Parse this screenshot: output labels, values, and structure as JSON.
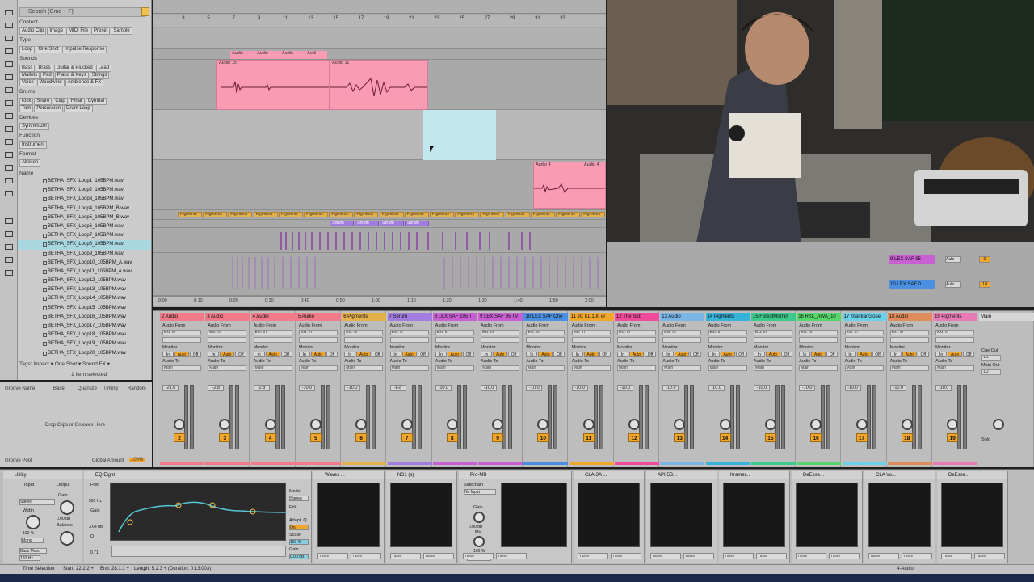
{
  "search": {
    "placeholder": "Search (Cmd + F)"
  },
  "browser": {
    "content_label": "Content",
    "content_chips": [
      "Audio Clip",
      "Image",
      "MIDI File",
      "Preset",
      "Sample"
    ],
    "type_label": "Type",
    "type_chips": [
      "Loop",
      "One Shot",
      "Impulse Response"
    ],
    "sounds_label": "Sounds",
    "sounds_rows": [
      [
        "Bass",
        "Brass",
        "Guitar & Plucked",
        "Lead"
      ],
      [
        "Mallets",
        "Pad",
        "Piano & Keys",
        "Strings"
      ],
      [
        "Voice",
        "Woodwind",
        "Ambience & FX"
      ]
    ],
    "drums_label": "Drums",
    "drums_rows": [
      [
        "Kick",
        "Snare",
        "Clap",
        "Hihat",
        "Cymbal"
      ],
      [
        "Tom",
        "Percussion",
        "Drum Loop"
      ]
    ],
    "devices_label": "Devices",
    "devices_chips": [
      "Synthesizer"
    ],
    "function_label": "Function",
    "function_chips": [
      "Instrument"
    ],
    "format_label": "Format",
    "format_chips": [
      "Ableton"
    ],
    "name_header": "Name",
    "files": [
      "BETHA_SFX_Loop1_105BPM.wav",
      "BETHA_SFX_Loop2_105BPM.wav",
      "BETHA_SFX_Loop3_105BPM.wav",
      "BETHA_SFX_Loop4_105BPM_B.wav",
      "BETHA_SFX_Loop5_105BPM_B.wav",
      "BETHA_SFX_Loop6_105BPM.wav",
      "BETHA_SFX_Loop7_105BPM.wav",
      "BETHA_SFX_Loop8_105BPM.wav",
      "BETHA_SFX_Loop9_105BPM.wav",
      "BETHA_SFX_Loop10_105BPM_A.wav",
      "BETHA_SFX_Loop11_105BPM_A.wav",
      "BETHA_SFX_Loop12_105BPM.wav",
      "BETHA_SFX_Loop13_105BPM.wav",
      "BETHA_SFX_Loop14_105BPM.wav",
      "BETHA_SFX_Loop15_105BPM.wav",
      "BETHA_SFX_Loop16_105BPM.wav",
      "BETHA_SFX_Loop17_105BPM.wav",
      "BETHA_SFX_Loop18_105BPM.wav",
      "BETHA_SFX_Loop19_105BPM.wav",
      "BETHA_SFX_Loop20_105BPM.wav"
    ],
    "selected_index": 7,
    "tags": "Tags: Impact ▾  One Shot ▾  Sound FX ▾",
    "selected_count": "1 Item selected"
  },
  "groove": {
    "cols": [
      "Groove Name",
      "Base",
      "Quantize",
      "Timing",
      "Random"
    ],
    "drop": "Drop Clips or Grooves Here",
    "pool": "Groove Pool",
    "global": "Global Amount",
    "global_val": "100%"
  },
  "arrangement": {
    "bars": [
      "1",
      "3",
      "5",
      "7",
      "9",
      "11",
      "13",
      "15",
      "17",
      "19",
      "21",
      "23",
      "25",
      "27",
      "29",
      "31",
      "33"
    ],
    "clips_top": [
      "Audio",
      "Audio",
      "Audio",
      "Audi"
    ],
    "clip_audio15": "Audio 15",
    "clip_audio11": "Audio 11",
    "clip_audio4a": "Audio 4",
    "clip_audio4b": "Audio 4",
    "pigments": "Pigments",
    "serum": "Serum",
    "times": [
      "0:00",
      "0:10",
      "0:20",
      "0:30",
      "0:40",
      "0:50",
      "1:00",
      "1:10",
      "1:20",
      "1:30",
      "1:40",
      "1:50",
      "2:00"
    ]
  },
  "right_headers": [
    {
      "name": "9 LEX SAF 95",
      "color": "#c85fd2",
      "mode": "Auto",
      "val": "9"
    },
    {
      "name": "10 LEX SAF 0",
      "color": "#4a8fe0",
      "mode": "Auto",
      "val": "10"
    }
  ],
  "mixer": {
    "tracks": [
      {
        "name": "2 Audio",
        "color": "#f27b8a",
        "num": "2",
        "vol": "-21.6"
      },
      {
        "name": "3 Audio",
        "color": "#f27b8a",
        "num": "3",
        "vol": "-2.8"
      },
      {
        "name": "4 Audio",
        "color": "#f27b8a",
        "num": "4",
        "vol": "-2.8"
      },
      {
        "name": "5 Audio",
        "color": "#f27b8a",
        "num": "5",
        "vol": "-10.0"
      },
      {
        "name": "6 Pigments",
        "color": "#e5b04c",
        "num": "6",
        "vol": "-10.0"
      },
      {
        "name": "7 Serum",
        "color": "#a27de0",
        "num": "7",
        "vol": "-8.8"
      },
      {
        "name": "8 LEX SAF 105 T",
        "color": "#c85fd2",
        "num": "8",
        "vol": "-10.0"
      },
      {
        "name": "9 LEX SAF 95 TV",
        "color": "#c85fd2",
        "num": "9",
        "vol": "-10.0"
      },
      {
        "name": "10 LEX SAF One",
        "color": "#4a8fe0",
        "num": "10",
        "vol": "-10.0"
      },
      {
        "name": "11 JC KL 100 er",
        "color": "#f2a62b",
        "num": "11",
        "vol": "-10.0"
      },
      {
        "name": "12 The Sub",
        "color": "#f04a9c",
        "num": "12",
        "vol": "-10.0"
      },
      {
        "name": "13 Audio",
        "color": "#7ab5e8",
        "num": "13",
        "vol": "-10.0"
      },
      {
        "name": "14 Pigments",
        "color": "#35b3d8",
        "num": "14",
        "vol": "-10.0"
      },
      {
        "name": "15 ForestMornin",
        "color": "#3cc98a",
        "num": "15",
        "vol": "-10.0"
      },
      {
        "name": "16 RKL_AWA_10",
        "color": "#56d66a",
        "num": "16",
        "vol": "-10.0"
      },
      {
        "name": "17 @antiancrose",
        "color": "#6bd0e8",
        "num": "17",
        "vol": "-10.0"
      },
      {
        "name": "18 Audio",
        "color": "#e08c5a",
        "num": "18",
        "vol": "-10.0"
      },
      {
        "name": "19 Pigments",
        "color": "#e87ab4",
        "num": "19",
        "vol": "-10.0"
      }
    ],
    "audio_from": "Audio From",
    "ext_in": "Ext. In",
    "monitor": "Monitor",
    "in": "In",
    "auto": "Auto",
    "off": "Off",
    "audio_to": "Audio To",
    "main": "Main",
    "master": {
      "name": "Main",
      "cue": "Cue Out",
      "cue_val": "1/2",
      "main_out": "Main Out",
      "main_val": "1/2",
      "solo": "Solo"
    }
  },
  "devices": {
    "utility": {
      "title": "Utility",
      "input": "Input",
      "output": "Output",
      "width": "Width",
      "balance": "Balance",
      "gain": "Gain",
      "mono": "Mono",
      "bass_mono": "Bass Mono",
      "stereo": "Stereo",
      "width_val": "100 %",
      "gain_val": "0.00 dB",
      "bass_val": "120 Hz"
    },
    "eq": {
      "title": "EQ Eight",
      "freq": "Freq",
      "freq_val": "599 Hz",
      "gain_label": "Gain",
      "gain_val": "3.64 dB",
      "q": "Q",
      "q_val": "0.71",
      "mode": "Mode",
      "mode_val": "Stereo",
      "edit": "Edit",
      "adapt": "Adapt. Q",
      "adapt_val": "On",
      "scale": "Scale",
      "scale_val": "100 %",
      "gain2": "Gain",
      "gain2_val": "0.00 dB"
    },
    "plugins": [
      "Waves ...",
      "NS1 (s)",
      "Pro-MB",
      "CLA-3A ...",
      "API-5B...",
      "Kramer...",
      "DeEsse...",
      "CLA Vo...",
      "DeEsse..."
    ],
    "pro_mb": {
      "sidechain": "Sidechain",
      "no_input": "No Input",
      "gain": "Gain",
      "gain_val": "0.00 dB",
      "mix": "Mix",
      "mix_val": "100 %",
      "mute": "Mute"
    },
    "none": "none"
  },
  "status": {
    "left": "Time Selection",
    "start": "Start: 22.2.2 +",
    "end": "End: 28.1.1 +",
    "length": "Length: 5.2.3 + (Duration: 0:13:003)",
    "track": "4-Audio"
  },
  "colors": {
    "pink_clip": "#f99cb3",
    "selection": "#c3e7ee",
    "orange": "#f2a62b"
  }
}
